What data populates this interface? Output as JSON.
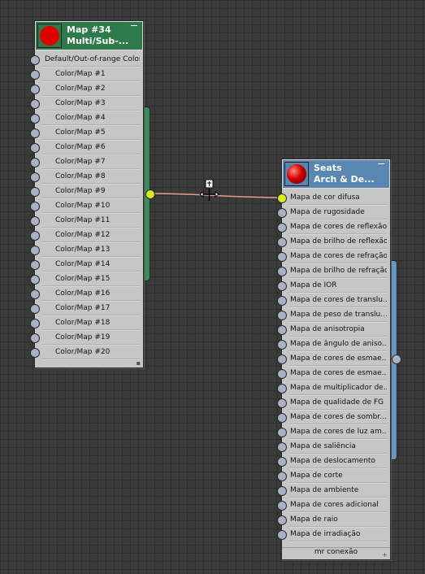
{
  "colors": {
    "map_header": "#2e7a4a",
    "map_bar": "#3f8a5a",
    "seats_header": "#5a86b2",
    "seats_bar": "#6a96c2",
    "wire": "#e89a9a",
    "active_socket": "#d6ef22"
  },
  "map_node": {
    "title": "Map #34",
    "subtitle": "Multi/Sub-...",
    "thumbnail": "red-flat-swatch",
    "slots": [
      "Default/Out-of-range Color",
      "Color/Map #1",
      "Color/Map #2",
      "Color/Map #3",
      "Color/Map #4",
      "Color/Map #5",
      "Color/Map #6",
      "Color/Map #7",
      "Color/Map #8",
      "Color/Map #9",
      "Color/Map #10",
      "Color/Map #11",
      "Color/Map #12",
      "Color/Map #13",
      "Color/Map #14",
      "Color/Map #15",
      "Color/Map #16",
      "Color/Map #17",
      "Color/Map #18",
      "Color/Map #19",
      "Color/Map #20"
    ]
  },
  "seats_node": {
    "title": "Seats",
    "subtitle": "Arch & De...",
    "thumbnail": "red-sphere-swatch",
    "connected_slot": "Mapa de cor difusa",
    "slots": [
      "Mapa de cor difusa",
      "Mapa de rugosidade",
      "Mapa de cores de reflexão",
      "Mapa de brilho de reflexão",
      "Mapa de cores de refração",
      "Mapa de brilho de refração",
      "Mapa de IOR",
      "Mapa de cores de translu...",
      "Mapa de peso de translu...",
      "Mapa de anisotropia",
      "Mapa de ângulo de aniso...",
      "Mapa de cores de esmae...",
      "Mapa de cores de esmae...",
      "Mapa de multiplicador de...",
      "Mapa de qualidade de FG",
      "Mapa de cores de sombr...",
      "Mapa de cores de luz am...",
      "Mapa de saliência",
      "Mapa de deslocamento",
      "Mapa de corte",
      "Mapa de ambiente",
      "Mapa de cores adicional",
      "Mapa de raio",
      "Mapa de irradiação"
    ],
    "footer": "mr conexão"
  },
  "cursor": "move-cursor-icon"
}
